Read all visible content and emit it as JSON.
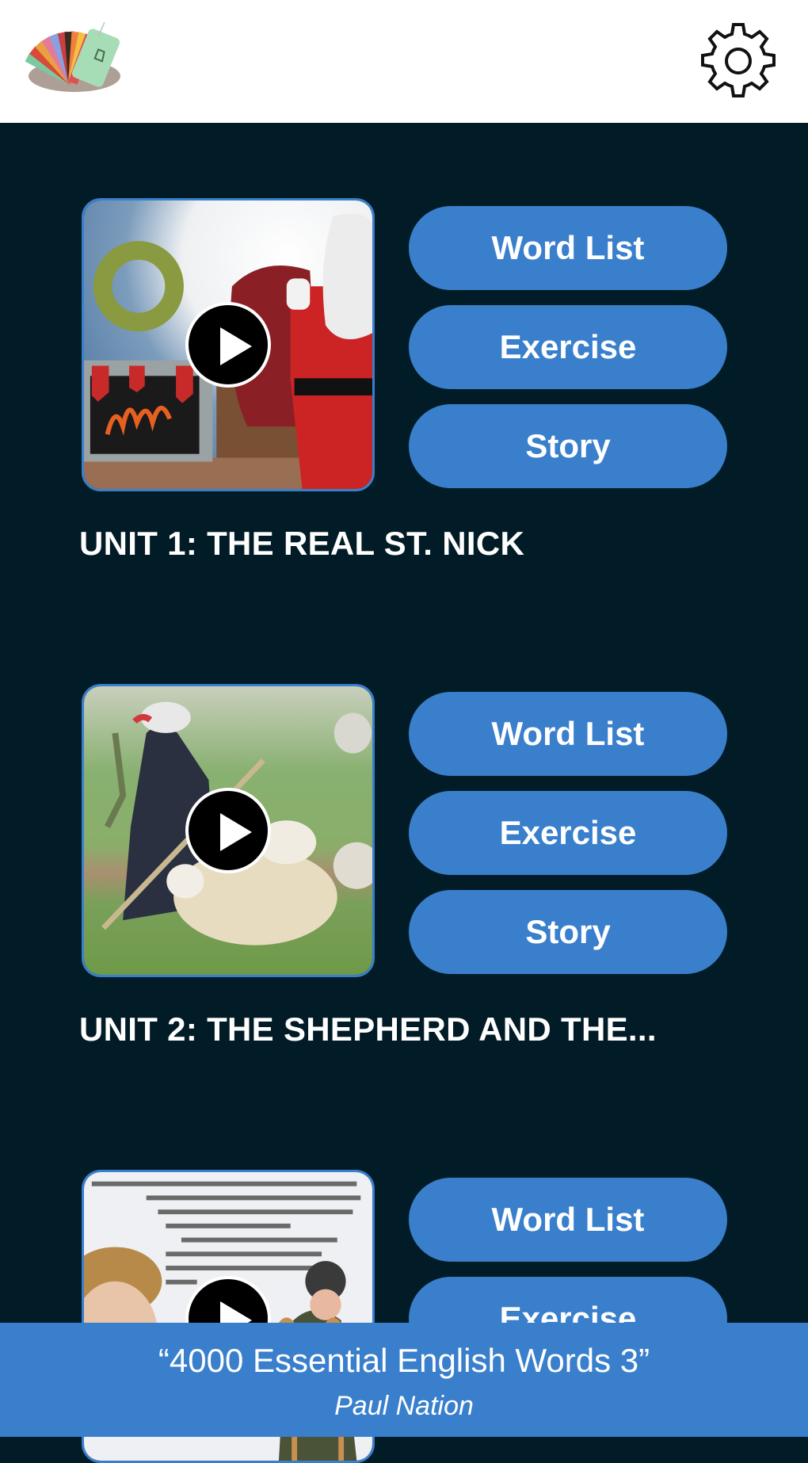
{
  "header": {
    "logo": "flashcards-logo",
    "settings_icon": "gear-icon"
  },
  "colors": {
    "background": "#011c26",
    "accent": "#3a7fcc",
    "header_bg": "#ffffff",
    "text": "#ffffff"
  },
  "units": [
    {
      "title": "UNIT 1: THE REAL ST. NICK",
      "thumbnail": "santa-claus-fireplace-image",
      "buttons": [
        "Word List",
        "Exercise",
        "Story"
      ]
    },
    {
      "title": "UNIT 2: THE SHEPHERD AND THE...",
      "thumbnail": "shepherd-with-sheep-image",
      "buttons": [
        "Word List",
        "Exercise",
        "Story"
      ]
    },
    {
      "title": "",
      "thumbnail": "boys-with-sled-story-image",
      "buttons": [
        "Word List",
        "Exercise"
      ]
    }
  ],
  "footer": {
    "book_title": "“4000 Essential English Words 3”",
    "author": "Paul Nation"
  }
}
